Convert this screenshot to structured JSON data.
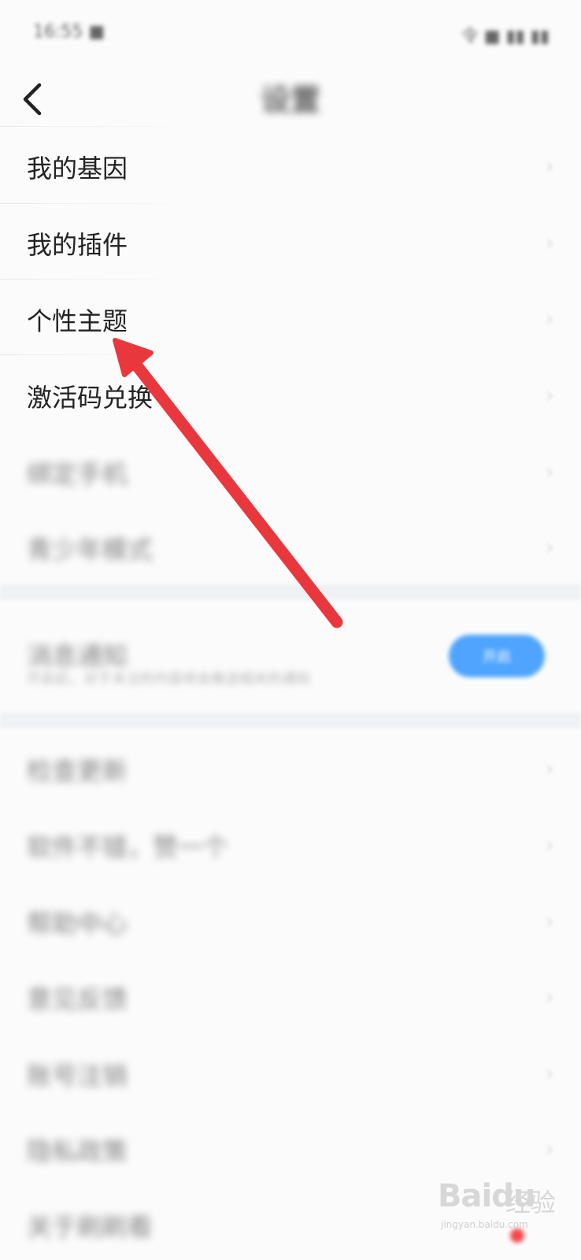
{
  "status_bar": {
    "time": "16:55 ■",
    "icons": "令 ■ ▮▮ ▮▮"
  },
  "header": {
    "title": "设置",
    "back_icon": "chevron-left-icon"
  },
  "menu_group_1": [
    {
      "label": "我的基因"
    },
    {
      "label": "我的插件"
    },
    {
      "label": "个性主题"
    },
    {
      "label": "激活码兑换"
    },
    {
      "label": "绑定手机"
    },
    {
      "label": "青少年模式"
    }
  ],
  "toggle_item": {
    "title": "消息通知",
    "subtitle": "开启后，对于关注的内容将会推送相关的通知",
    "button_label": "开启"
  },
  "menu_group_2": [
    {
      "label": "检查更新"
    },
    {
      "label": "软件不错，赞一个"
    },
    {
      "label": "帮助中心"
    },
    {
      "label": "意见反馈"
    },
    {
      "label": "账号注销"
    },
    {
      "label": "隐私政策"
    },
    {
      "label": "关于刷刷看"
    }
  ],
  "chevron": "›",
  "watermark": {
    "brand": "Baidu",
    "cn": "经验",
    "url": "jingyan.baidu.com"
  },
  "colors": {
    "arrow": "#e8383d",
    "toggle": "#3d9bff",
    "badge": "#f24a4a"
  }
}
